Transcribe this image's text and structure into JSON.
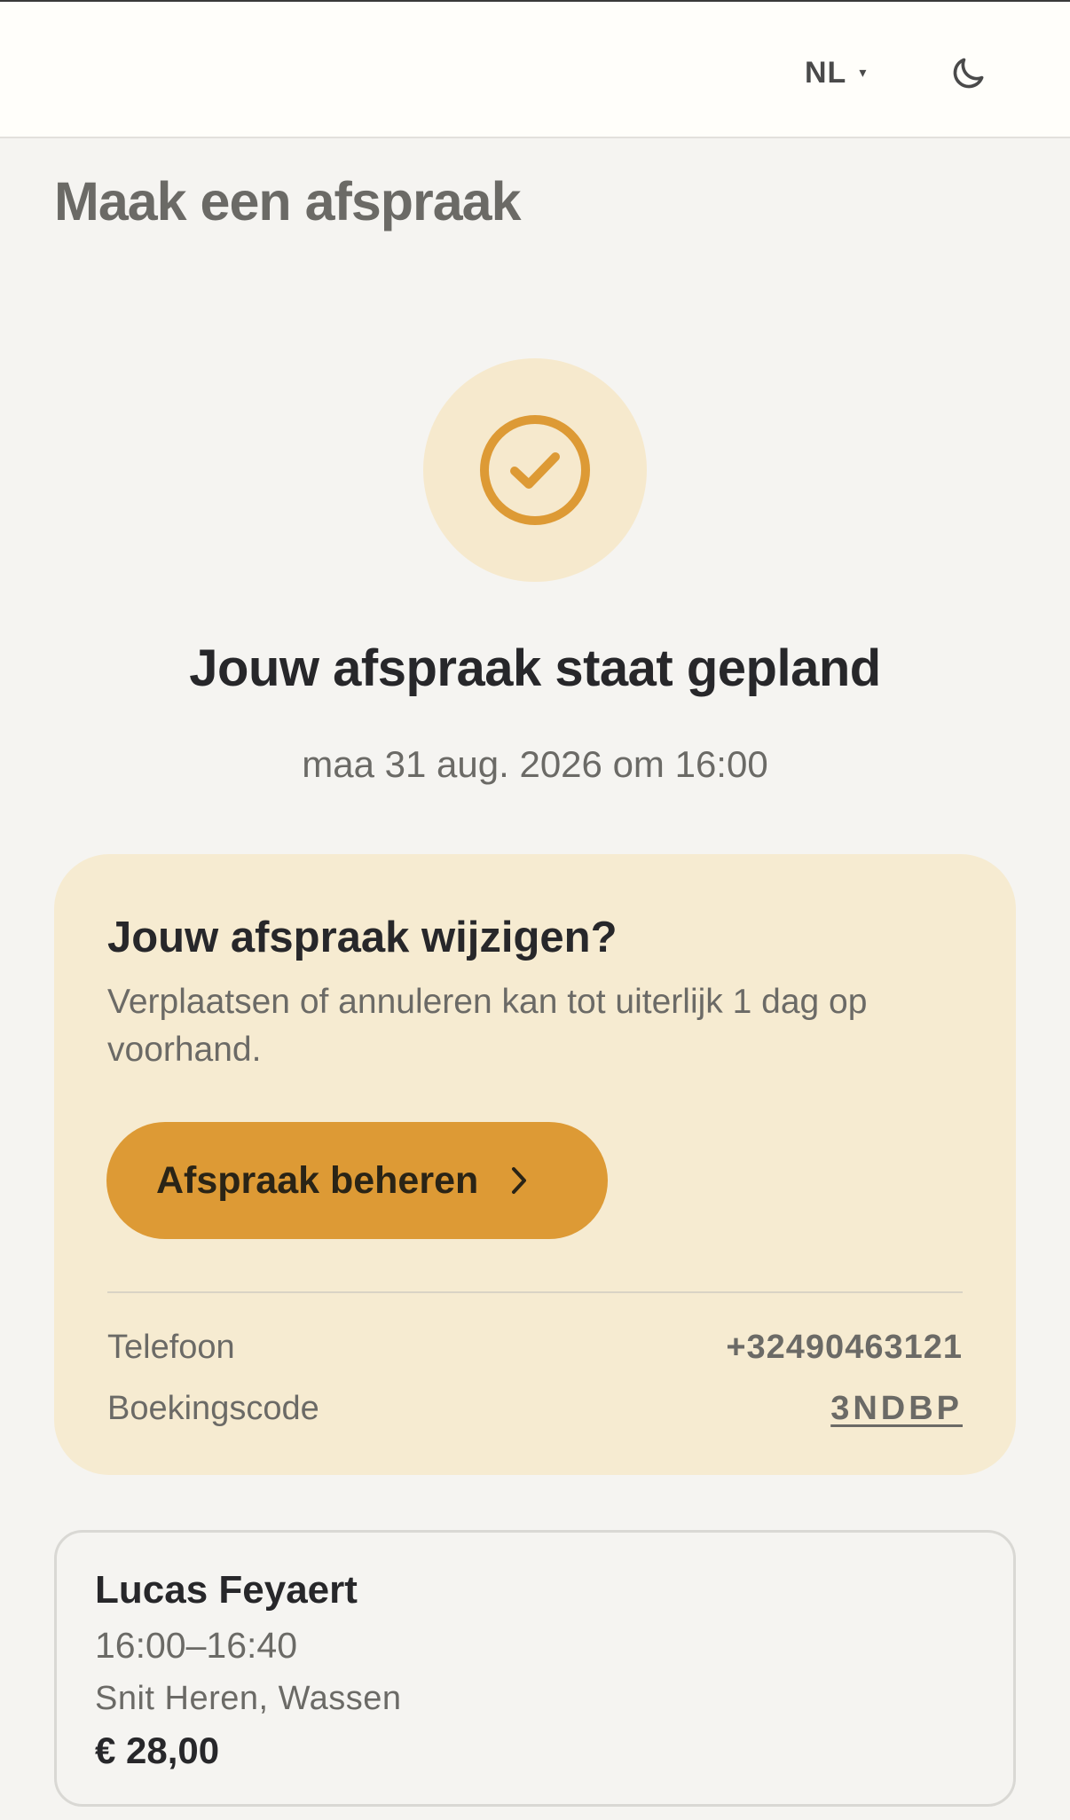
{
  "header": {
    "language": "NL",
    "language_caret": "▾",
    "theme_icon": "moon-icon"
  },
  "page": {
    "title": "Maak een afspraak"
  },
  "confirmation": {
    "icon": "check-circle-icon",
    "heading": "Jouw afspraak staat gepland",
    "datetime": "maa 31 aug. 2026 om 16:00"
  },
  "manage": {
    "title": "Jouw afspraak wijzigen?",
    "description": "Verplaatsen of annuleren kan tot uiterlijk 1 dag op voorhand.",
    "button_label": "Afspraak beheren",
    "button_icon": "chevron-right-icon",
    "phone_label": "Telefoon",
    "phone_value": "+32490463121",
    "code_label": "Boekingscode",
    "code_value": "3NDBP"
  },
  "appointment": {
    "staff": "Lucas Feyaert",
    "time": "16:00–16:40",
    "services": "Snit Heren, Wassen",
    "price": "€ 28,00"
  },
  "colors": {
    "accent": "#dd9a35",
    "accent_light": "#f6e9cd",
    "card_background": "#f6ebd1",
    "page_background": "#f5f4f1"
  }
}
